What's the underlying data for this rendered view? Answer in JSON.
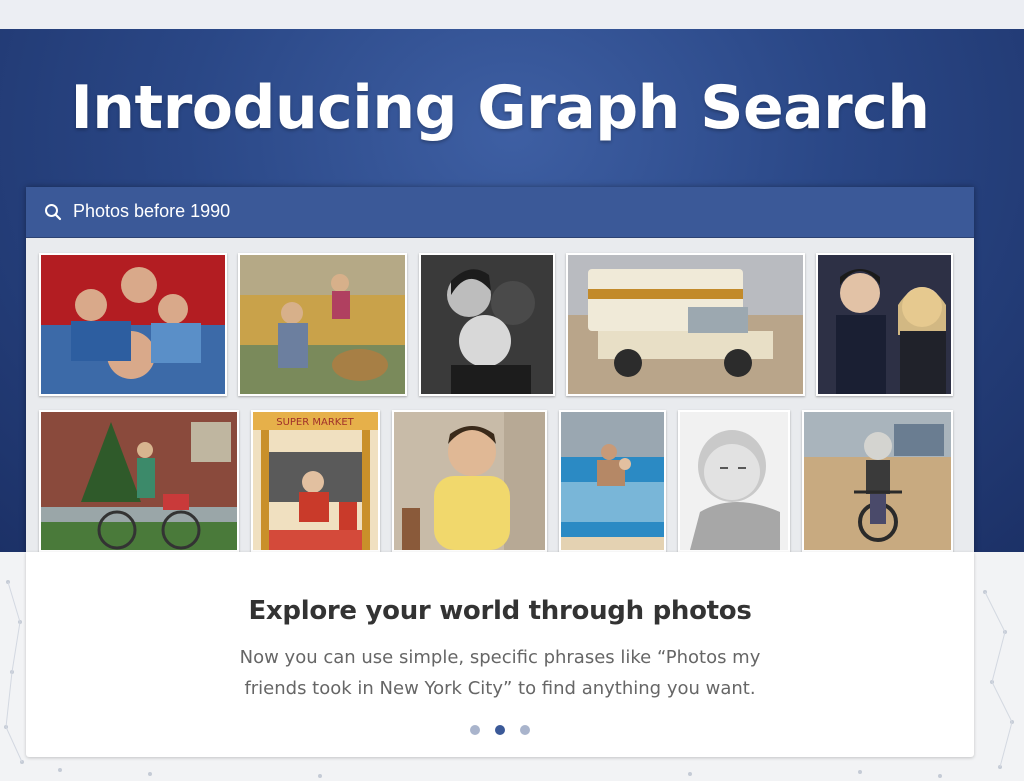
{
  "headline": "Introducing Graph Search",
  "search": {
    "query": "Photos before 1990",
    "icon": "search-icon"
  },
  "photos": [
    {
      "name": "photo-kids-group",
      "palette": [
        "#b31d22",
        "#3c6aa8",
        "#d9a98a"
      ]
    },
    {
      "name": "photo-family-field",
      "palette": [
        "#c9a24a",
        "#7a8a5b",
        "#e0c98a"
      ]
    },
    {
      "name": "photo-bw-portrait",
      "palette": [
        "#1c1c1c",
        "#7d7d7d",
        "#d8d8d8"
      ]
    },
    {
      "name": "photo-camper-truck",
      "palette": [
        "#b9a58a",
        "#d8c7a0",
        "#8f7c61"
      ]
    },
    {
      "name": "photo-couple-portrait",
      "palette": [
        "#1a1f33",
        "#e6d3b5",
        "#394060"
      ]
    },
    {
      "name": "photo-woman-bicycle",
      "palette": [
        "#8a4a3c",
        "#4a7a3a",
        "#d0b070"
      ]
    },
    {
      "name": "photo-supermarket-child",
      "palette": [
        "#e6b04a",
        "#c93a2a",
        "#f0e0c0"
      ]
    },
    {
      "name": "photo-toddler-sweater",
      "palette": [
        "#c8bba8",
        "#f1d86c",
        "#8a7058"
      ]
    },
    {
      "name": "photo-pool",
      "palette": [
        "#2b8ac4",
        "#79b6d8",
        "#e4d2b2"
      ]
    },
    {
      "name": "photo-baby-bw",
      "palette": [
        "#f1f1f1",
        "#a7a7a7",
        "#585858"
      ]
    },
    {
      "name": "photo-child-bike-helmet",
      "palette": [
        "#c8aa80",
        "#6a7d91",
        "#d7c5a0"
      ]
    }
  ],
  "card": {
    "title": "Explore your world through photos",
    "description": "Now you can use simple, specific phrases like “Photos my friends took in New York City” to find anything you want."
  },
  "carousel": {
    "total": 3,
    "active_index": 1
  },
  "colors": {
    "brand": "#3b5998",
    "hero_dark": "#1c3167",
    "hero_light": "#3e5fa3"
  }
}
